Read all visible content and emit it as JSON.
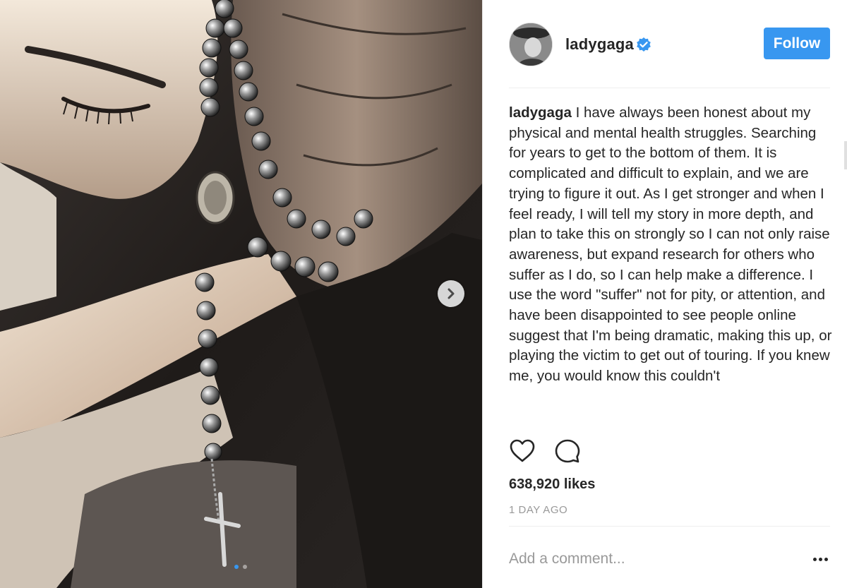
{
  "post": {
    "username": "ladygaga",
    "verified": true,
    "follow_label": "Follow",
    "caption_text": " I have always been honest about my physical and mental health struggles. Searching for years to get to the bottom of them. It is complicated and difficult to explain, and we are trying to figure it out. As I get stronger and when I feel ready, I will tell my story in more depth, and plan to take this on strongly so I can not only raise awareness, but expand research for others who suffer as I do, so I can help make a difference. I use the word \"suffer\" not for pity, or attention, and have been disappointed to see people online suggest that I'm being dramatic, making this up, or playing the victim to get out of touring. If you knew me, you would know this couldn't",
    "likes": "638,920 likes",
    "time": "1 DAY AGO",
    "comment_placeholder": "Add a comment..."
  },
  "photo": {
    "description_icon": "photo-praying-hands-rosary",
    "carousel_total": 2,
    "carousel_active": 1
  },
  "colors": {
    "accent": "#3897f0",
    "text": "#262626",
    "muted": "#999999"
  },
  "icons": {
    "verified": "verified-badge-icon",
    "like": "heart-icon",
    "comment": "comment-bubble-icon",
    "next": "chevron-right-icon",
    "more": "more-options-icon"
  }
}
